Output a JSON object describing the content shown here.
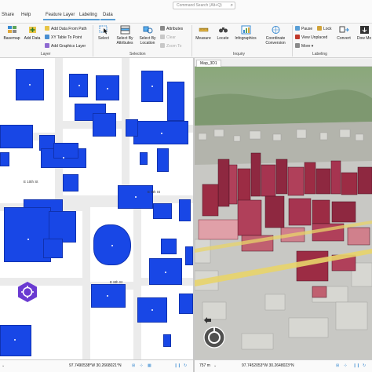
{
  "menu": {
    "share": "Share",
    "help": "Help"
  },
  "context_tabs": [
    "Feature Layer",
    "Labeling",
    "Data"
  ],
  "command_search": {
    "placeholder": "Command Search (Alt+Q)"
  },
  "ribbon": {
    "basemap": "Basemap",
    "add_data": "Add Data",
    "add_data_from_path": "Add Data From Path",
    "xy_table_to_point": "XY Table To Point",
    "add_graphics_layer": "Add Graphics Layer",
    "select": "Select",
    "select_by_attributes": "Select By Attributes",
    "select_by_location": "Select By Location",
    "attributes": "Attributes",
    "clear": "Clear",
    "zoom_to": "Zoom To",
    "measure": "Measure",
    "locate": "Locate",
    "infographics": "Infographics",
    "coordinate_conversion": "Coordinate Conversion",
    "pause": "Pause",
    "lock": "Lock",
    "view_unplaced": "View Unplaced",
    "more": "More",
    "convert": "Convert",
    "down": "Dow Mo",
    "groups": {
      "layer": "Layer",
      "selection": "Selection",
      "inquiry": "Inquiry",
      "labeling": "Labeling"
    }
  },
  "scene_tab": "Map_3D1",
  "streets": [
    "E 10th St",
    "E 9th St",
    "E 8th St"
  ],
  "status_left": {
    "coords": "97.7490538°W 30.2668021°N"
  },
  "status_right": {
    "scale": "757 m",
    "coords": "97.7452053°W 30.2648023°N"
  },
  "colors": {
    "building2d": "#1847e6",
    "building3d": "#9c2c44",
    "accent": "#5a9fd6",
    "road": "#e8d46a"
  }
}
